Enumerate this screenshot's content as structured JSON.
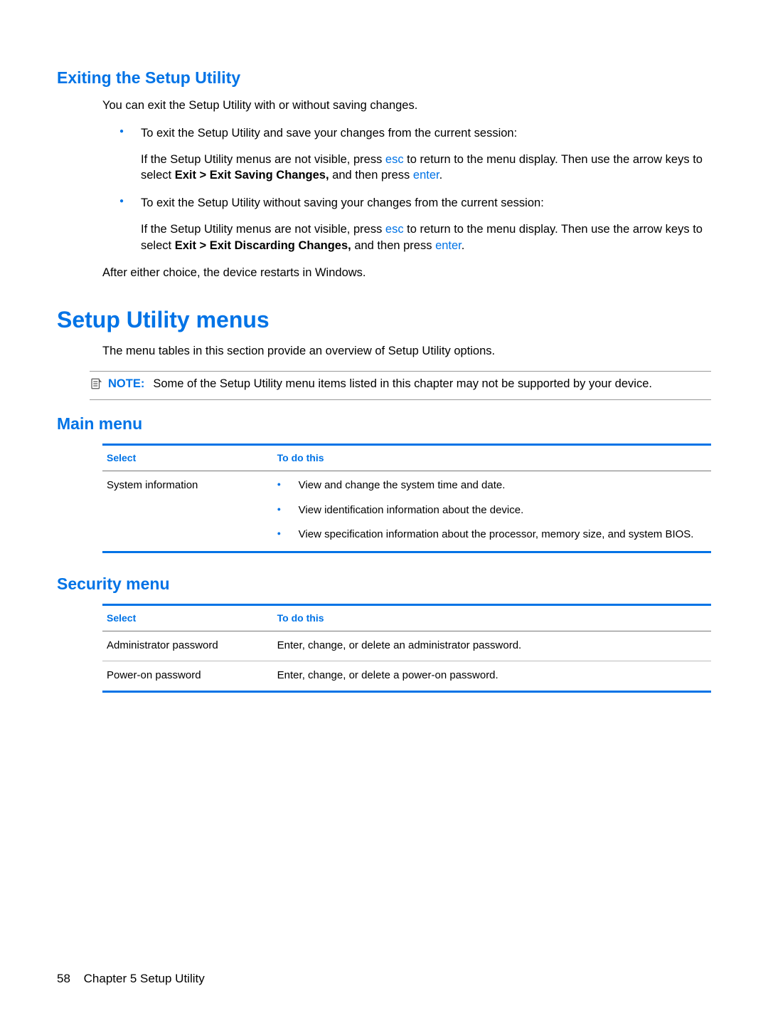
{
  "headings": {
    "exiting": "Exiting the Setup Utility",
    "menus": "Setup Utility menus",
    "main_menu": "Main menu",
    "security_menu": "Security menu"
  },
  "exiting": {
    "intro": "You can exit the Setup Utility with or without saving changes.",
    "bullet1_lead": "To exit the Setup Utility and save your changes from the current session:",
    "bullet1_sub_pre": "If the Setup Utility menus are not visible, press ",
    "bullet1_sub_key1": "esc",
    "bullet1_sub_mid": " to return to the menu display. Then use the arrow keys to select ",
    "bullet1_sub_bold": "Exit > Exit Saving Changes,",
    "bullet1_sub_post": " and then press ",
    "bullet1_sub_key2": "enter",
    "bullet1_sub_end": ".",
    "bullet2_lead": "To exit the Setup Utility without saving your changes from the current session:",
    "bullet2_sub_pre": "If the Setup Utility menus are not visible, press ",
    "bullet2_sub_key1": "esc",
    "bullet2_sub_mid": " to return to the menu display. Then use the arrow keys to select ",
    "bullet2_sub_bold": "Exit > Exit Discarding Changes,",
    "bullet2_sub_post": " and then press ",
    "bullet2_sub_key2": "enter",
    "bullet2_sub_end": ".",
    "after": "After either choice, the device restarts in Windows."
  },
  "menus_intro": "The menu tables in this section provide an overview of Setup Utility options.",
  "note": {
    "label": "NOTE:",
    "text": "Some of the Setup Utility menu items listed in this chapter may not be supported by your device."
  },
  "table_headers": {
    "select": "Select",
    "todo": "To do this"
  },
  "main_table": {
    "row1_select": "System information",
    "row1_items": {
      "0": "View and change the system time and date.",
      "1": "View identification information about the device.",
      "2": "View specification information about the processor, memory size, and system BIOS."
    }
  },
  "security_table": {
    "row1_select": "Administrator password",
    "row1_todo": "Enter, change, or delete an administrator password.",
    "row2_select": "Power-on password",
    "row2_todo": "Enter, change, or delete a power-on password."
  },
  "footer": {
    "page": "58",
    "chapter": "Chapter 5   Setup Utility"
  }
}
